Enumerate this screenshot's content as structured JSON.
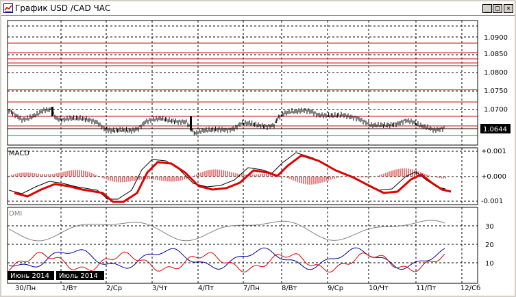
{
  "window": {
    "title": "График USD /CAD  ЧАС",
    "buttons": {
      "minimize": "_",
      "maximize": "□",
      "close": "×"
    }
  },
  "price_panel": {
    "current_price": "1.0644",
    "axis_labels": [
      "1.0900",
      "1.0850",
      "1.0800",
      "1.0750",
      "1.0700"
    ],
    "colors": {
      "resistance": "#cc0000",
      "support": "#009900",
      "candles": "#000000"
    }
  },
  "macd_panel": {
    "label": "MACD",
    "axis_labels": [
      "+0.001",
      "+0.000",
      "-0.001"
    ],
    "colors": {
      "histogram": "#cc0000",
      "macd": "#000000",
      "signal": "#e00000"
    }
  },
  "dmi_panel": {
    "label": "DMI",
    "axis_labels": [
      "30",
      "20",
      "10"
    ],
    "colors": {
      "adx": "#808080",
      "plus_di": "#000099",
      "minus_di": "#dd0000"
    }
  },
  "time_axis": {
    "dates": [
      "30/Пн",
      "1/Вт",
      "2/Ср",
      "3/Чт",
      "4/Пт",
      "7/Пн",
      "8/Вт",
      "9/Ср",
      "10/Чт",
      "11/Пт",
      "12/Сб"
    ],
    "months": [
      "Июнь 2014",
      "Июль 2014"
    ]
  }
}
